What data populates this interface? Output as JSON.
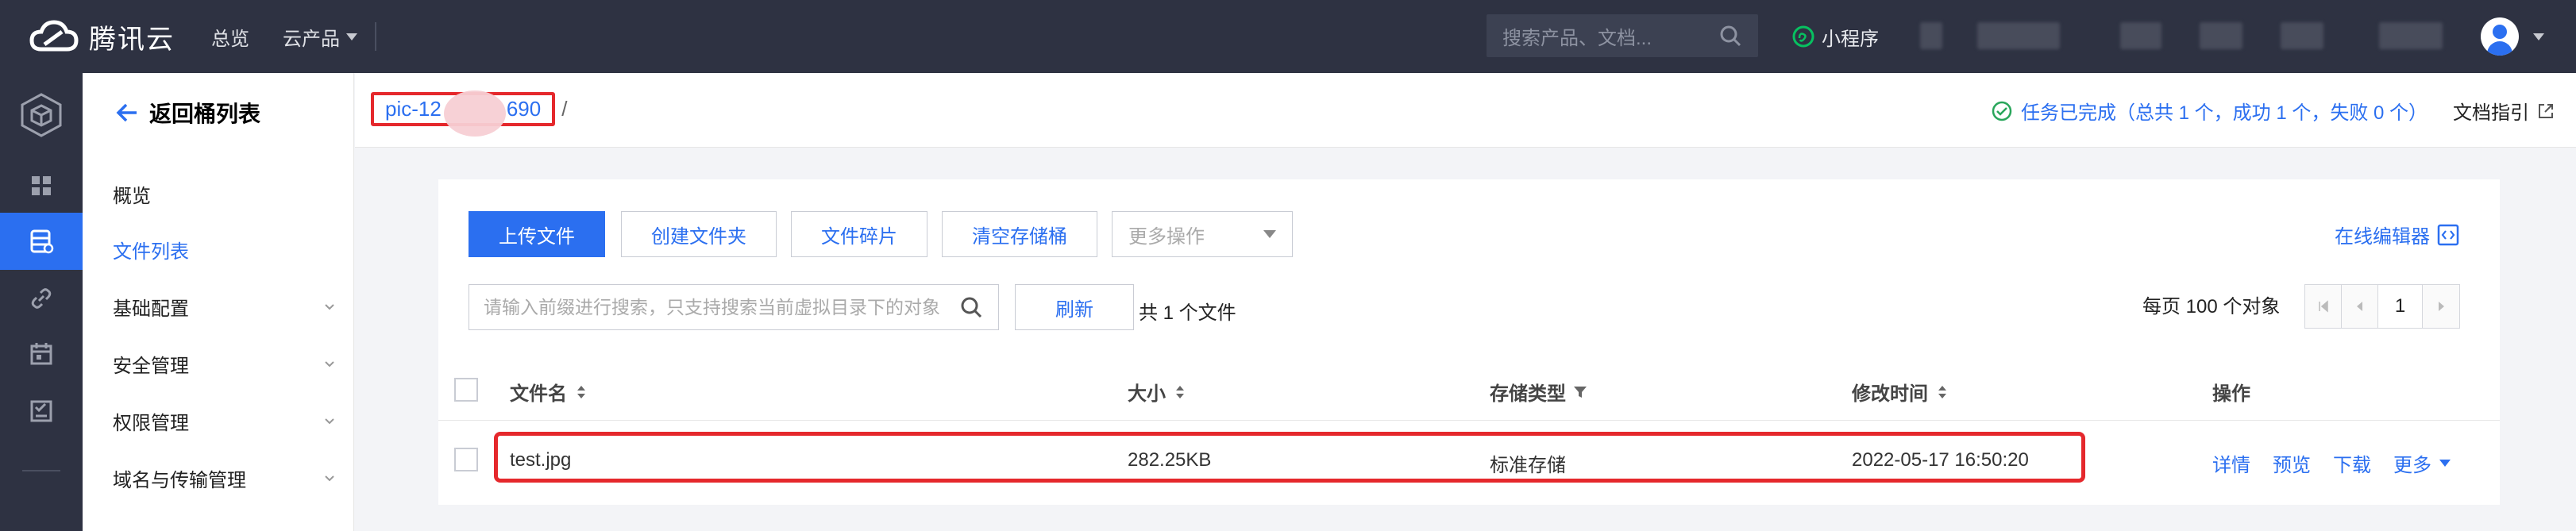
{
  "topbar": {
    "brand": "腾讯云",
    "nav": [
      "总览",
      "云产品"
    ],
    "search_placeholder": "搜索产品、文档...",
    "mini_program": "小程序"
  },
  "sidebar": {
    "back_label": "返回桶列表",
    "items": [
      {
        "label": "概览",
        "active": false,
        "expandable": false
      },
      {
        "label": "文件列表",
        "active": true,
        "expandable": false
      },
      {
        "label": "基础配置",
        "active": false,
        "expandable": true
      },
      {
        "label": "安全管理",
        "active": false,
        "expandable": true
      },
      {
        "label": "权限管理",
        "active": false,
        "expandable": true
      },
      {
        "label": "域名与传输管理",
        "active": false,
        "expandable": true
      }
    ]
  },
  "breadcrumb": {
    "bucket_left": "pic-12",
    "bucket_right": "690",
    "separator": "/"
  },
  "task_status": "任务已完成（总共 1 个，成功 1 个，失败 0 个）",
  "doc_link": "文档指引",
  "toolbar": {
    "upload": "上传文件",
    "create_folder": "创建文件夹",
    "fragments": "文件碎片",
    "clear_bucket": "清空存储桶",
    "more_ops": "更多操作",
    "online_editor": "在线编辑器"
  },
  "search": {
    "placeholder": "请输入前缀进行搜索，只支持搜索当前虚拟目录下的对象",
    "refresh": "刷新",
    "count": "共 1 个文件"
  },
  "pagination": {
    "per_page": "每页 100 个对象",
    "current_page": "1"
  },
  "table": {
    "columns": [
      "文件名",
      "大小",
      "存储类型",
      "修改时间",
      "操作"
    ],
    "rows": [
      {
        "name": "test.jpg",
        "size": "282.25KB",
        "storage_class": "标准存储",
        "modified": "2022-05-17 16:50:20",
        "actions": [
          "详情",
          "预览",
          "下载",
          "更多"
        ]
      }
    ]
  },
  "colors": {
    "accent": "#2b6ff0",
    "topbar": "#2e3242",
    "highlight": "#e5282c",
    "success": "#29a65b"
  }
}
